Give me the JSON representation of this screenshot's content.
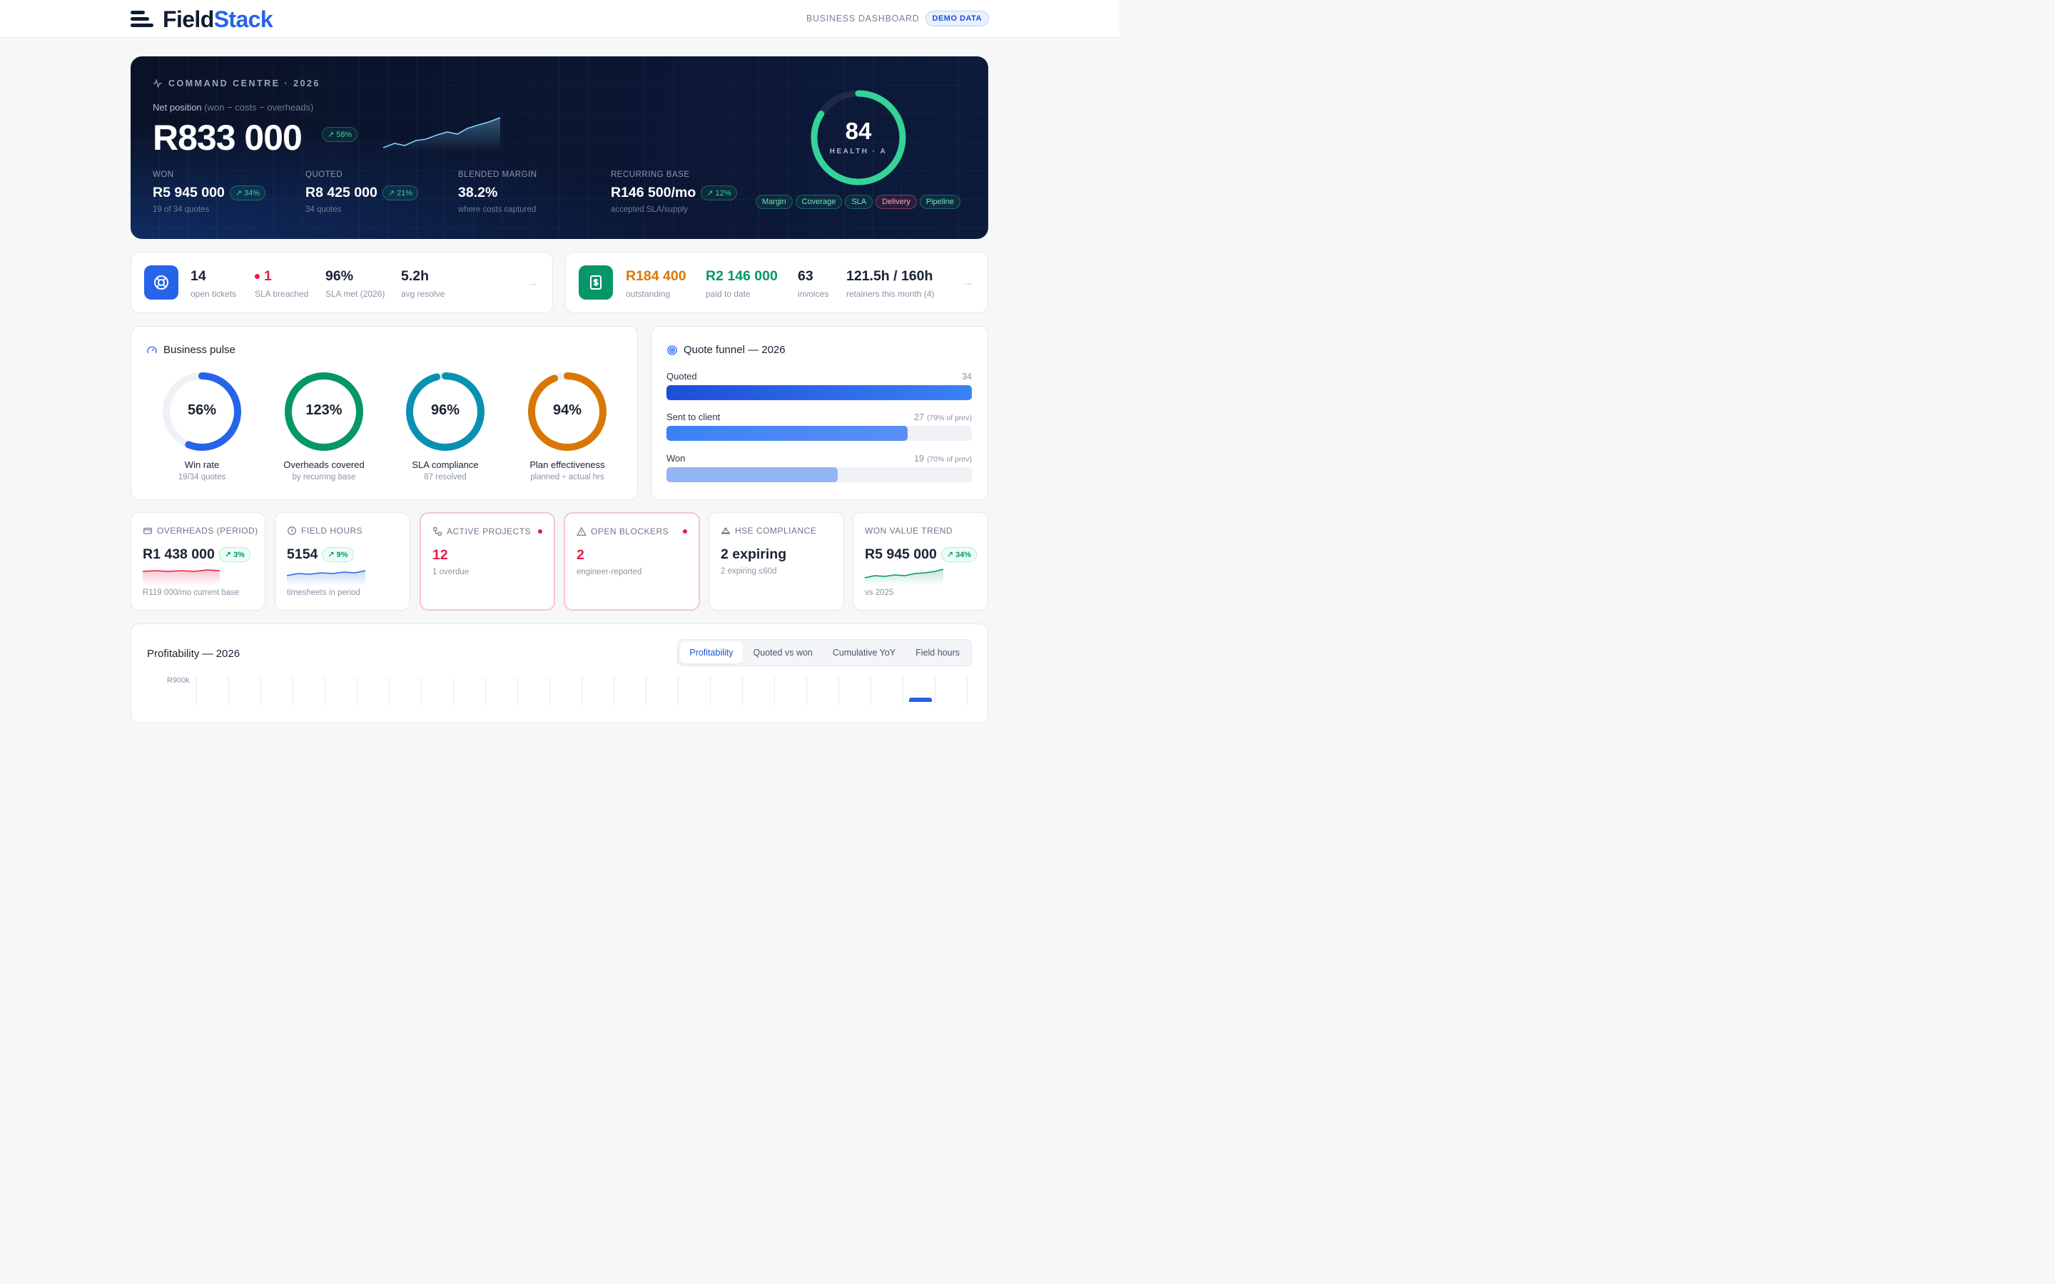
{
  "brand": {
    "name_a": "Field",
    "name_b": "Stack"
  },
  "topbar": {
    "section": "BUSINESS DASHBOARD",
    "badge": "DEMO DATA"
  },
  "hero": {
    "eyebrow": "COMMAND CENTRE · 2026",
    "sub_label": "Net position",
    "sub_note": "(won − costs − overheads)",
    "net_value": "R833 000",
    "net_change": "58%",
    "stats": [
      {
        "label": "WON",
        "value": "R5 945 000",
        "change": "34%",
        "sub": "19 of 34 quotes"
      },
      {
        "label": "QUOTED",
        "value": "R8 425 000",
        "change": "21%",
        "sub": "34 quotes"
      },
      {
        "label": "BLENDED MARGIN",
        "value": "38.2%",
        "sub": "where costs captured"
      },
      {
        "label": "RECURRING BASE",
        "value": "R146 500/mo",
        "change": "12%",
        "sub": "accepted SLA/supply"
      }
    ],
    "health": {
      "score": "84",
      "label": "HEALTH · A",
      "fraction": 0.84
    },
    "tags": [
      "Margin",
      "Coverage",
      "SLA",
      "Delivery",
      "Pipeline"
    ]
  },
  "support": {
    "icon": "lifebuoy-icon",
    "items": [
      {
        "value": "14",
        "label": "open tickets"
      },
      {
        "value": "1",
        "label": "SLA breached"
      },
      {
        "value": "96%",
        "label": "SLA met (2026)"
      },
      {
        "value": "5.2h",
        "label": "avg resolve"
      }
    ]
  },
  "billing": {
    "icon": "invoice-icon",
    "items": [
      {
        "value": "R184 400",
        "label": "outstanding"
      },
      {
        "value": "R2 146 000",
        "label": "paid to date"
      },
      {
        "value": "63",
        "label": "invoices"
      },
      {
        "value": "121.5h / 160h",
        "label": "retainers this month (4)"
      }
    ]
  },
  "pulse": {
    "title": "Business pulse",
    "rings": [
      {
        "pct": "56%",
        "title": "Win rate",
        "sub": "19/34 quotes",
        "fraction": 0.56,
        "color": "#2563eb"
      },
      {
        "pct": "123%",
        "title": "Overheads covered",
        "sub": "by recurring base",
        "fraction": 1.0,
        "color": "#059669"
      },
      {
        "pct": "96%",
        "title": "SLA compliance",
        "sub": "87 resolved",
        "fraction": 0.96,
        "color": "#0891b2"
      },
      {
        "pct": "94%",
        "title": "Plan effectiveness",
        "sub": "planned ÷ actual hrs",
        "fraction": 0.94,
        "color": "#d97706"
      }
    ]
  },
  "funnel": {
    "title": "Quote funnel — 2026",
    "rows": [
      {
        "label": "Quoted",
        "count": "34",
        "note": "",
        "fraction": 1.0
      },
      {
        "label": "Sent to client",
        "count": "27",
        "note": "(79% of prev)",
        "fraction": 0.79
      },
      {
        "label": "Won",
        "count": "19",
        "note": "(70% of prev)",
        "fraction": 0.56
      }
    ]
  },
  "kpis": [
    {
      "title": "OVERHEADS (PERIOD)",
      "icon": "wallet-icon",
      "value": "R1 438 000",
      "change": "3%",
      "sub": "R119 000/mo current base"
    },
    {
      "title": "FIELD HOURS",
      "icon": "clock-icon",
      "value": "5154",
      "change": "9%",
      "sub": "timesheets in period"
    },
    {
      "title": "ACTIVE PROJECTS",
      "icon": "project-icon",
      "value": "12",
      "sub": "1 overdue"
    },
    {
      "title": "OPEN BLOCKERS",
      "icon": "warning-icon",
      "value": "2",
      "sub": "engineer-reported"
    },
    {
      "title": "HSE COMPLIANCE",
      "icon": "hardhat-icon",
      "value": "2 expiring",
      "sub": "2 expiring ≤60d"
    },
    {
      "title": "WON VALUE TREND",
      "value": "R5 945 000",
      "change": "34%",
      "sub": "vs 2025"
    }
  ],
  "profit": {
    "title": "Profitability — 2026",
    "tabs": [
      "Profitability",
      "Quoted vs won",
      "Cumulative YoY",
      "Field hours"
    ],
    "active_tab": "Profitability",
    "y_top": "R900k"
  }
}
